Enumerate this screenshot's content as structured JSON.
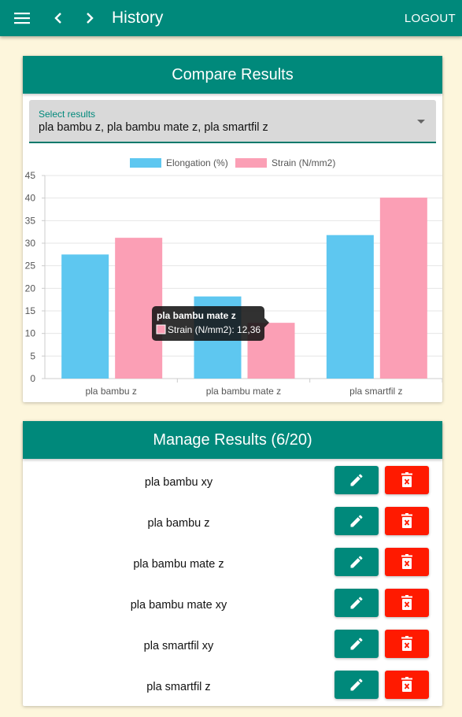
{
  "appbar": {
    "title": "History",
    "logout_label": "LOGOUT",
    "icons": [
      "menu-icon",
      "chevron-left-icon",
      "chevron-right-icon"
    ]
  },
  "compare": {
    "title": "Compare Results",
    "select_label": "Select results",
    "select_value": "pla bambu z, pla bambu mate z, pla smartfil z"
  },
  "tooltip": {
    "title": "pla bambu mate z",
    "text": "Strain (N/mm2): 12,36"
  },
  "chart_data": {
    "type": "bar",
    "categories": [
      "pla bambu z",
      "pla bambu mate z",
      "pla smartfil z"
    ],
    "series": [
      {
        "name": "Elongation (%)",
        "values": [
          27.5,
          18.2,
          31.8
        ],
        "color": "#5ec7f0"
      },
      {
        "name": "Strain (N/mm2)",
        "values": [
          31.2,
          12.36,
          40.1
        ],
        "color": "#fb9fb5"
      }
    ],
    "ylim": [
      0,
      45
    ],
    "yticks": [
      0,
      5,
      10,
      15,
      20,
      25,
      30,
      35,
      40,
      45
    ],
    "legend": "top",
    "grid": true
  },
  "manage": {
    "title": "Manage Results (6/20)",
    "items": [
      {
        "name": "pla bambu xy"
      },
      {
        "name": "pla bambu z"
      },
      {
        "name": "pla bambu mate z"
      },
      {
        "name": "pla bambu mate xy"
      },
      {
        "name": "pla smartfil xy"
      },
      {
        "name": "pla smartfil z"
      }
    ],
    "icons": {
      "edit": "pencil-icon",
      "delete": "trash-icon"
    }
  },
  "colors": {
    "primary": "#00897b",
    "danger": "#ff1a00",
    "background": "#fdf6dc"
  }
}
